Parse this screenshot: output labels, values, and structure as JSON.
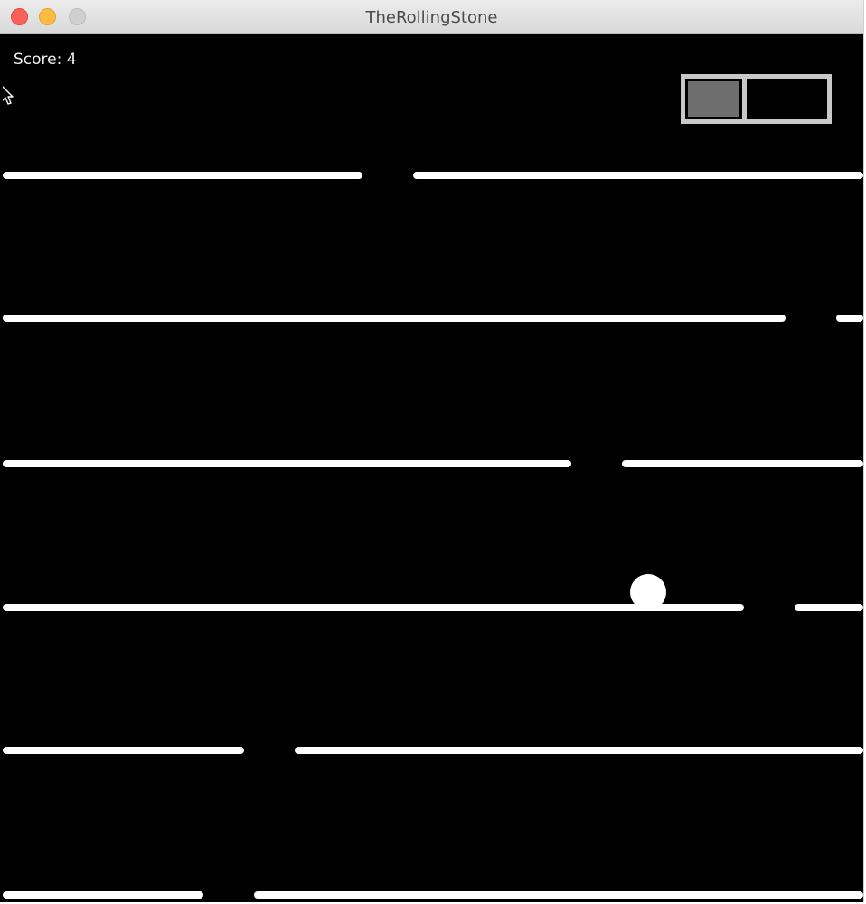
{
  "window": {
    "title": "TheRollingStone"
  },
  "hud": {
    "score_text": "Score: 4",
    "score": 4
  },
  "power_meter": {
    "segments": 2,
    "filled_segments": 1
  },
  "colors": {
    "background": "#000000",
    "platform": "#ffffff",
    "ball": "#ffffff",
    "meter_border": "#c8c8c8",
    "meter_fill": "#6e6e6e"
  },
  "icons": {
    "cursor": "mouse-pointer-icon",
    "ball": "ball-icon"
  }
}
